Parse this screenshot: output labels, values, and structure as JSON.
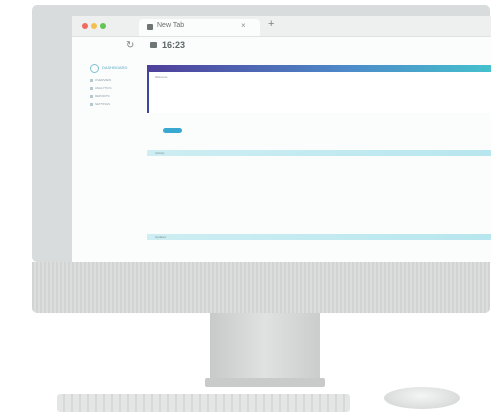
{
  "browser": {
    "traffic_lights": [
      "#f06b5f",
      "#f5bf4f",
      "#62c554"
    ],
    "tab": {
      "title": "New Tab",
      "close_glyph": "×"
    },
    "new_tab_glyph": "+",
    "reload_glyph": "↻",
    "address": {
      "value": "16:23"
    }
  },
  "sidebar": {
    "brand": "DASHBOARD",
    "items": [
      {
        "label": "OVERVIEW"
      },
      {
        "label": "ANALYTICS"
      },
      {
        "label": "REPORTS"
      },
      {
        "label": "SETTINGS"
      }
    ]
  },
  "main": {
    "hero_gradient": [
      "#4e3f9a",
      "#4d89c9",
      "#44c6cd"
    ],
    "card_label": "Welcome",
    "primary_button_color": "#3aa9d2",
    "sections": [
      {
        "label": "Activity"
      },
      {
        "label": "Updates"
      }
    ]
  },
  "colors": {
    "accent": "#3aa9d2",
    "band": "#cdeef3"
  }
}
